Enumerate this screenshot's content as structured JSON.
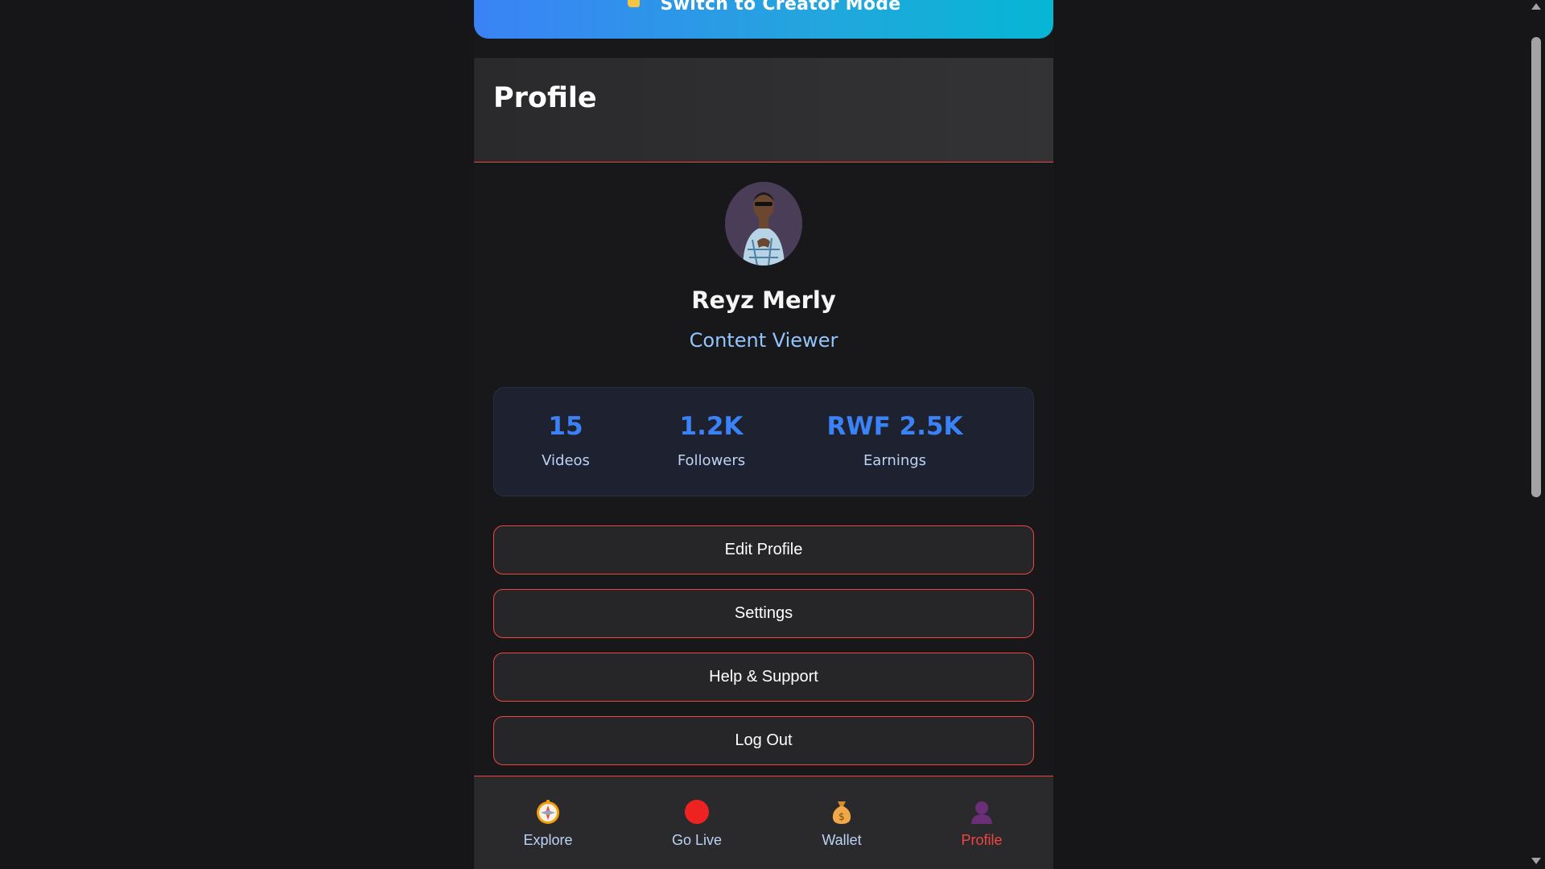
{
  "banner": {
    "label": "Switch to Creator Mode",
    "icon": "pointing-hand-icon"
  },
  "header": {
    "title": "Profile"
  },
  "user": {
    "name": "Reyz Merly",
    "role": "Content Viewer",
    "avatar": "profile-photo"
  },
  "stats": [
    {
      "value": "15",
      "label": "Videos"
    },
    {
      "value": "1.2K",
      "label": "Followers"
    },
    {
      "value": "RWF 2.5K",
      "label": "Earnings"
    }
  ],
  "menu": {
    "edit_profile": "Edit Profile",
    "settings": "Settings",
    "help_support": "Help & Support",
    "log_out": "Log Out"
  },
  "nav": [
    {
      "label": "Explore",
      "icon": "compass-icon",
      "active": false
    },
    {
      "label": "Go Live",
      "icon": "record-dot-icon",
      "active": false
    },
    {
      "label": "Wallet",
      "icon": "money-bag-icon",
      "active": false
    },
    {
      "label": "Profile",
      "icon": "user-icon",
      "active": true
    }
  ],
  "colors": {
    "accent": "#ef4444",
    "stat_blue": "#3b82f6",
    "role_blue": "#93c5fd",
    "banner_start": "#3b82f6",
    "banner_end": "#06b6d4"
  }
}
